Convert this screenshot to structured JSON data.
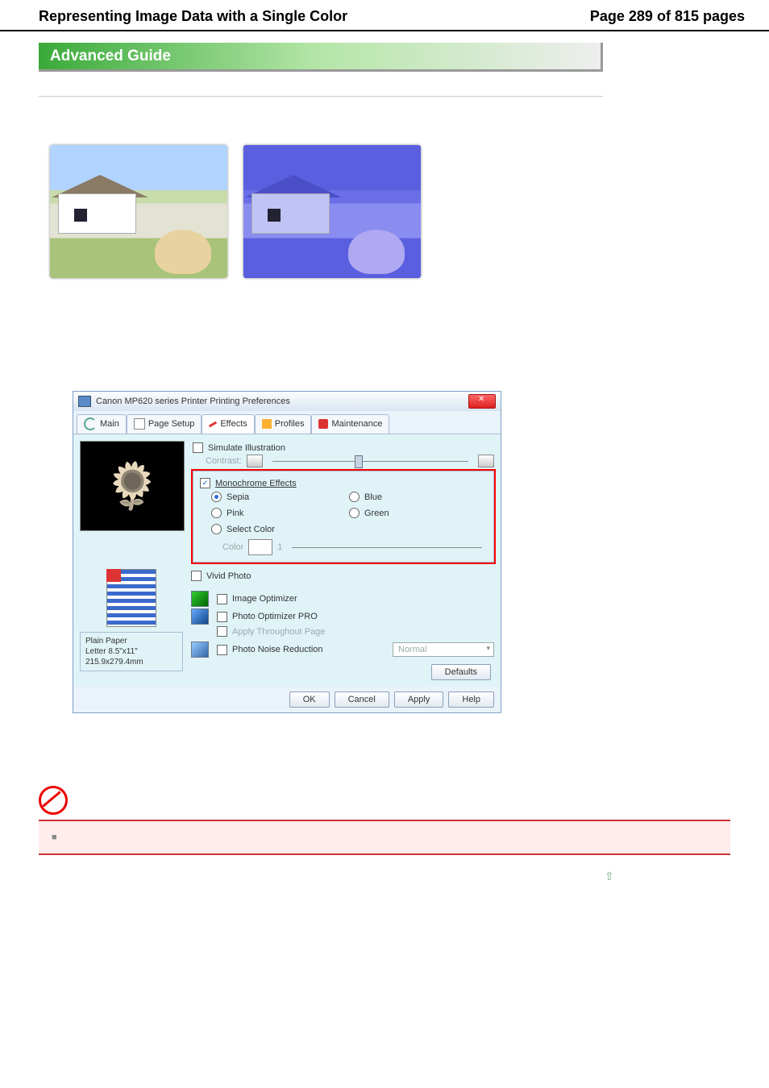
{
  "header": {
    "title": "Representing Image Data with a Single Color",
    "pager": "Page 289 of 815 pages"
  },
  "banner": "Advanced Guide",
  "dialog": {
    "title": "Canon MP620 series Printer Printing Preferences",
    "tabs": {
      "main": "Main",
      "page": "Page Setup",
      "effects": "Effects",
      "profiles": "Profiles",
      "maint": "Maintenance"
    },
    "sim": {
      "label": "Simulate Illustration",
      "contrast": "Contrast:"
    },
    "mono": {
      "group": "Monochrome Effects",
      "sepia": "Sepia",
      "pink": "Pink",
      "select": "Select Color",
      "blue": "Blue",
      "green": "Green",
      "color": "Color",
      "val": "1"
    },
    "opts": {
      "vivid": "Vivid Photo",
      "imgopt": "Image Optimizer",
      "pro": "Photo Optimizer PRO",
      "apply": "Apply Throughout Page",
      "noise": "Photo Noise Reduction",
      "normal": "Normal"
    },
    "paper": {
      "l1": "Plain Paper",
      "l2": "Letter 8.5\"x11\" 215.9x279.4mm"
    },
    "buttons": {
      "defaults": "Defaults",
      "ok": "OK",
      "cancel": "Cancel",
      "apply": "Apply",
      "help": "Help"
    }
  },
  "warn": {
    "bullet": "■"
  }
}
